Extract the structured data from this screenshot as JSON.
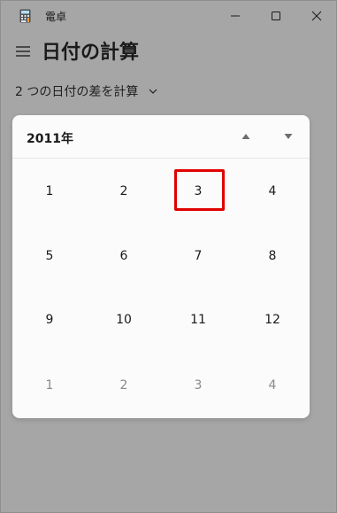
{
  "window": {
    "title": "電卓",
    "icon": "calculator-icon",
    "controls": [
      "minimize-icon",
      "maximize-icon",
      "close-icon"
    ]
  },
  "header": {
    "menu_icon": "hamburger-menu-icon",
    "title": "日付の計算"
  },
  "mode": {
    "selected": "2 つの日付の差を計算",
    "icon": "chevron-down-icon"
  },
  "calendar": {
    "year_label": "2011年",
    "nav": [
      "triangle-up-icon",
      "triangle-down-icon"
    ],
    "months": [
      {
        "label": "1",
        "muted": false
      },
      {
        "label": "2",
        "muted": false
      },
      {
        "label": "3",
        "muted": false,
        "current": true
      },
      {
        "label": "4",
        "muted": false
      },
      {
        "label": "5",
        "muted": false
      },
      {
        "label": "6",
        "muted": false
      },
      {
        "label": "7",
        "muted": false
      },
      {
        "label": "8",
        "muted": false
      },
      {
        "label": "9",
        "muted": false
      },
      {
        "label": "10",
        "muted": false
      },
      {
        "label": "11",
        "muted": false
      },
      {
        "label": "12",
        "muted": false
      },
      {
        "label": "1",
        "muted": true
      },
      {
        "label": "2",
        "muted": true
      },
      {
        "label": "3",
        "muted": true
      },
      {
        "label": "4",
        "muted": true
      }
    ]
  },
  "colors": {
    "window_bg": "#a6a6a6",
    "popup_bg": "#fbfbfb",
    "highlight": "#e00000"
  }
}
